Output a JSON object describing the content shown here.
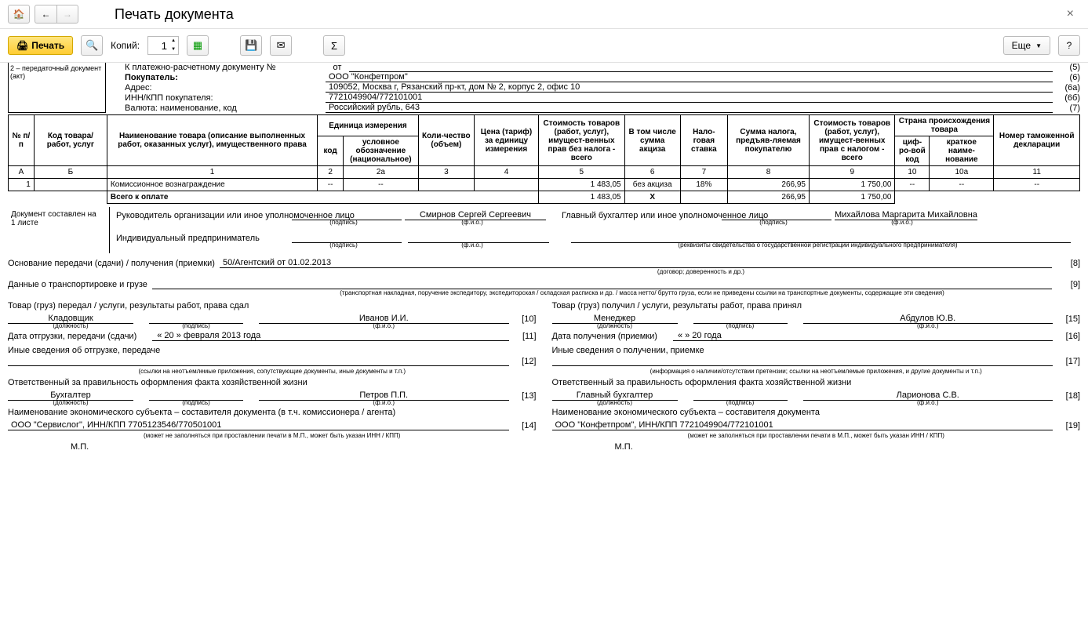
{
  "title": "Печать документа",
  "toolbar": {
    "print": "Печать",
    "copies_label": "Копий:",
    "copies_value": "1",
    "more": "Еще"
  },
  "doc_type": "2 – передаточный документ (акт)",
  "header": {
    "payment_doc_label": "К платежно-расчетному документу №",
    "payment_doc_ot": "от",
    "payment_doc_value": "",
    "buyer_label": "Покупатель:",
    "buyer_value": "ООО \"Конфетпром\"",
    "address_label": "Адрес:",
    "address_value": "109052, Москва г, Рязанский пр-кт, дом № 2, корпус 2, офис 10",
    "inn_label": "ИНН/КПП покупателя:",
    "inn_value": "7721049904/772101001",
    "currency_label": "Валюта: наименование, код",
    "currency_value": "Российский рубль, 643",
    "codes": {
      "payment": "(5)",
      "buyer": "(6)",
      "address": "(6а)",
      "inn": "(6б)",
      "currency": "(7)"
    }
  },
  "table": {
    "headers": {
      "num": "№ п/п",
      "code": "Код товара/ работ, услуг",
      "name": "Наименование товара (описание выполненных работ, оказанных услуг), имущественного права",
      "unit": "Единица измерения",
      "unit_code": "код",
      "unit_name": "условное обозначение (национальное)",
      "qty": "Коли-чество (объем)",
      "price": "Цена (тариф) за единицу измерения",
      "cost_no_tax": "Стоимость товаров (работ, услуг), имущест-венных прав без налога - всего",
      "excise": "В том числе сумма акциза",
      "tax_rate": "Нало-говая ставка",
      "tax_sum": "Сумма налога, предъяв-ляемая покупателю",
      "cost_with_tax": "Стоимость товаров (работ, услуг), имущест-венных прав с налогом - всего",
      "origin_country": "Страна происхождения товара",
      "origin_code": "циф-ро-вой код",
      "origin_name": "краткое наиме-нование",
      "customs_num": "Номер таможенной декларации"
    },
    "col_nums": [
      "А",
      "Б",
      "1",
      "2",
      "2а",
      "3",
      "4",
      "5",
      "6",
      "7",
      "8",
      "9",
      "10",
      "10а",
      "11"
    ],
    "rows": [
      {
        "num": "1",
        "code": "",
        "name": "Комиссионное вознаграждение",
        "unit_code": "--",
        "unit_name": "--",
        "qty": "",
        "price": "",
        "cost_no_tax": "1 483,05",
        "excise": "без акциза",
        "tax_rate": "18%",
        "tax_sum": "266,95",
        "cost_with_tax": "1 750,00",
        "orig_code": "--",
        "orig_name": "--",
        "customs": "--"
      }
    ],
    "total_label": "Всего к оплате",
    "total": {
      "cost_no_tax": "1 483,05",
      "excise": "Х",
      "tax_sum": "266,95",
      "cost_with_tax": "1 750,00"
    }
  },
  "sig": {
    "pages_label": "Документ составлен на",
    "pages_value": "1 листе",
    "leader_label": "Руководитель организации или иное уполномоченное лицо",
    "leader_fio": "Смирнов Сергей Сергеевич",
    "chief_acc_label": "Главный бухгалтер или иное уполномоченное лицо",
    "chief_acc_fio": "Михайлова Маргарита Михайловна",
    "ip_label": "Индивидуальный предприниматель",
    "hint_sign": "(подпись)",
    "hint_fio": "(ф.и.о.)",
    "hint_ip": "(реквизиты свидетельства о государственной регистрации индивидуального предпринимателя)"
  },
  "transfer": {
    "basis_label": "Основание передачи (сдачи) / получения (приемки)",
    "basis_value": "50/Агентский от 01.02.2013",
    "basis_code": "[8]",
    "basis_hint": "(договор; доверенность и др.)",
    "transport_label": "Данные о транспортировке и грузе",
    "transport_code": "[9]",
    "transport_hint": "(транспортная накладная, поручение экспедитору, экспедиторская / складская расписка и др. / масса нетто/ брутто груза, если не приведены ссылки на транспортные документы, содержащие эти сведения)"
  },
  "left_col": {
    "title": "Товар (груз) передал / услуги, результаты работ, права сдал",
    "position": "Кладовщик",
    "fio": "Иванов И.И.",
    "code": "[10]",
    "ship_date_label": "Дата отгрузки, передачи (сдачи)",
    "ship_date_value": "« 20 »  февраля  2013  года",
    "ship_date_code": "[11]",
    "other_label": "Иные сведения об отгрузке, передаче",
    "other_code": "[12]",
    "other_hint": "(ссылки на неотъемлемые приложения, сопутствующие документы, иные документы и т.п.)",
    "resp_label": "Ответственный за правильность оформления факта хозяйственной жизни",
    "resp_position": "Бухгалтер",
    "resp_fio": "Петров П.П.",
    "resp_code": "[13]",
    "subj_label": "Наименование экономического субъекта – составителя документа (в т.ч. комиссионера / агента)",
    "subj_value": "ООО \"Сервислог\", ИНН/КПП 7705123546/770501001",
    "subj_code": "[14]",
    "subj_hint": "(может не заполняться при проставлении печати в М.П., может быть указан ИНН / КПП)",
    "mp": "М.П."
  },
  "right_col": {
    "title": "Товар (груз) получил / услуги, результаты работ, права принял",
    "position": "Менеджер",
    "fio": "Абдулов Ю.В.",
    "code": "[15]",
    "recv_date_label": "Дата получения (приемки)",
    "recv_date_value": "«     »                    20     года",
    "recv_date_code": "[16]",
    "other_label": "Иные сведения о получении, приемке",
    "other_code": "[17]",
    "other_hint": "(информация о наличии/отсутствии претензии; ссылки на неотъемлемые приложения, и другие документы и т.п.)",
    "resp_label": "Ответственный за правильность оформления факта хозяйственной жизни",
    "resp_position": "Главный бухгалтер",
    "resp_fio": "Ларионова С.В.",
    "resp_code": "[18]",
    "subj_label": "Наименование экономического субъекта – составителя документа",
    "subj_value": "ООО \"Конфетпром\", ИНН/КПП 7721049904/772101001",
    "subj_code": "[19]",
    "subj_hint": "(может не заполняться при проставлении печати в М.П., может быть указан ИНН / КПП)",
    "mp": "М.П."
  },
  "hints": {
    "position": "(должность)",
    "sign": "(подпись)",
    "fio": "(ф.и.о.)"
  }
}
